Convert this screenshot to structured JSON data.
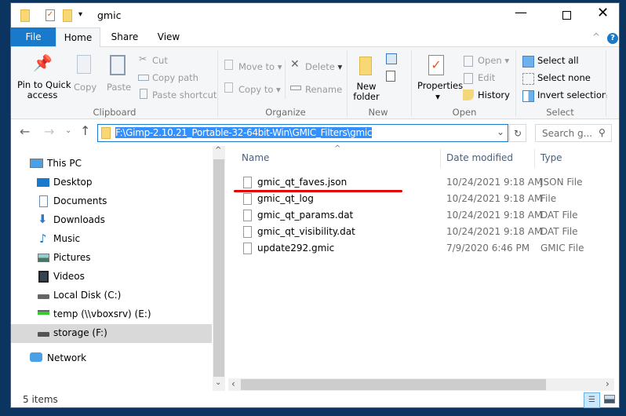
{
  "window": {
    "title": "gmic"
  },
  "tabs": [
    {
      "label": "File"
    },
    {
      "label": "Home"
    },
    {
      "label": "Share"
    },
    {
      "label": "View"
    }
  ],
  "ribbon": {
    "clipboard": {
      "label": "Clipboard",
      "pin": "Pin to Quick",
      "pin2": "access",
      "copy": "Copy",
      "paste": "Paste",
      "cut": "Cut",
      "copy_path": "Copy path",
      "paste_shortcut": "Paste shortcut"
    },
    "organize": {
      "label": "Organize",
      "move_to": "Move to",
      "copy_to": "Copy to",
      "delete": "Delete",
      "rename": "Rename"
    },
    "new": {
      "label": "New",
      "new_folder": "New",
      "new_folder2": "folder"
    },
    "open": {
      "label": "Open",
      "properties": "Properties",
      "open": "Open",
      "edit": "Edit",
      "history": "History"
    },
    "select": {
      "label": "Select",
      "select_all": "Select all",
      "select_none": "Select none",
      "invert": "Invert selection"
    }
  },
  "address": {
    "path": "F:\\Gimp-2.10.21_Portable-32-64bit-Win\\GMIC_Filters\\gmic",
    "search_placeholder": "Search g..."
  },
  "nav": [
    {
      "label": "This PC",
      "icon": "pc-icon"
    },
    {
      "label": "Desktop",
      "icon": "desktop-icon"
    },
    {
      "label": "Documents",
      "icon": "documents-icon"
    },
    {
      "label": "Downloads",
      "icon": "downloads-icon"
    },
    {
      "label": "Music",
      "icon": "music-icon"
    },
    {
      "label": "Pictures",
      "icon": "pictures-icon"
    },
    {
      "label": "Videos",
      "icon": "videos-icon"
    },
    {
      "label": "Local Disk (C:)",
      "icon": "disk-icon"
    },
    {
      "label": "temp (\\\\vboxsrv) (E:)",
      "icon": "network-drive-icon"
    },
    {
      "label": "storage (F:)",
      "icon": "disk-icon",
      "selected": true
    },
    {
      "label": "Network",
      "icon": "network-icon"
    }
  ],
  "columns": {
    "name": "Name",
    "date": "Date modified",
    "type": "Type"
  },
  "files": [
    {
      "name": "gmic_qt_faves.json",
      "date": "10/24/2021 9:18 AM",
      "type": "JSON File"
    },
    {
      "name": "gmic_qt_log",
      "date": "10/24/2021 9:18 AM",
      "type": "File"
    },
    {
      "name": "gmic_qt_params.dat",
      "date": "10/24/2021 9:18 AM",
      "type": "DAT File"
    },
    {
      "name": "gmic_qt_visibility.dat",
      "date": "10/24/2021 9:18 AM",
      "type": "DAT File"
    },
    {
      "name": "update292.gmic",
      "date": "7/9/2020 6:46 PM",
      "type": "GMIC File"
    }
  ],
  "status": {
    "items": "5 items"
  },
  "colors": {
    "accent": "#1979ca",
    "annotation": "#e00000",
    "selection": "#cce8ff"
  }
}
